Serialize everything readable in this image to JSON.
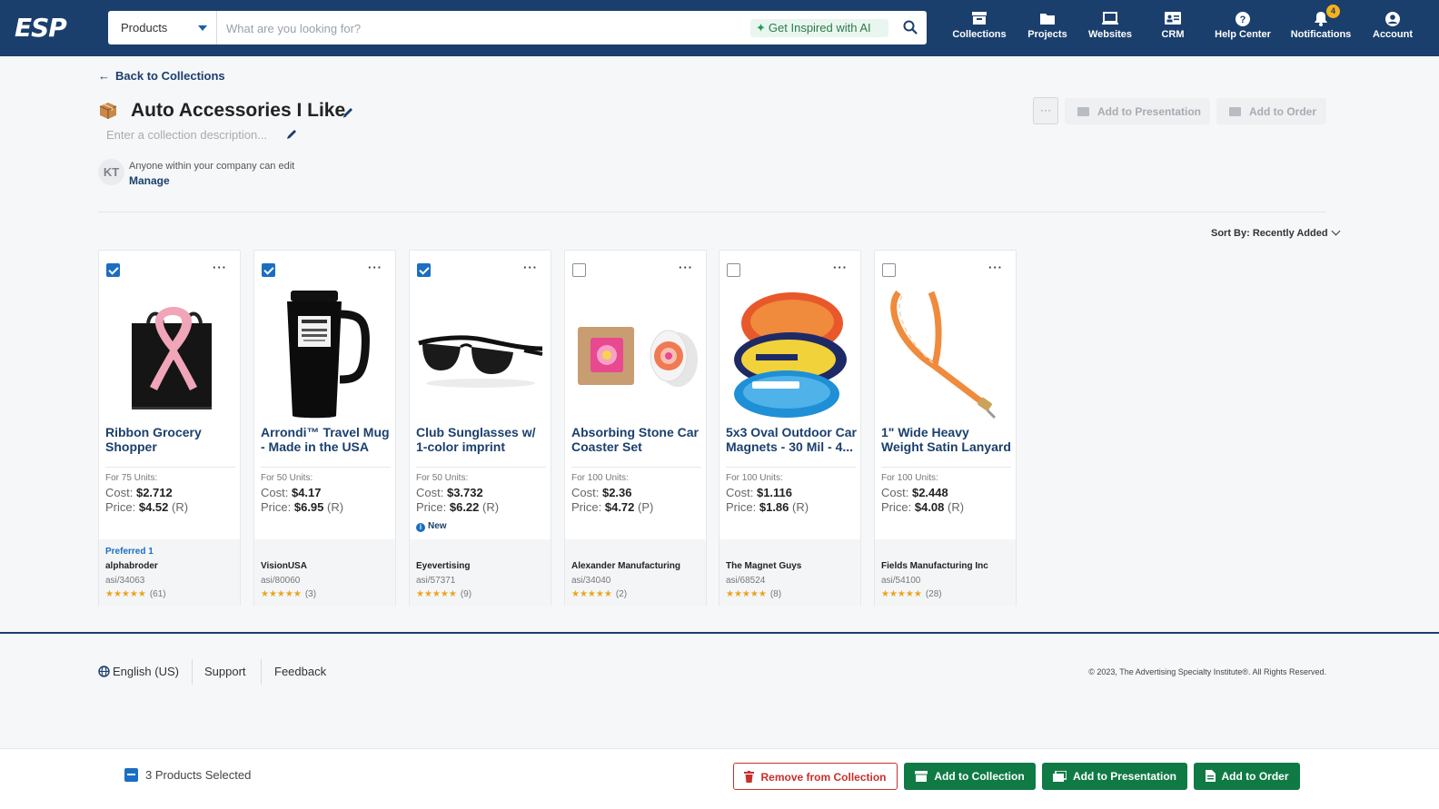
{
  "header": {
    "logo": "ESP",
    "search_category": "Products",
    "search_placeholder": "What are you looking for?",
    "ai_label": "Get Inspired with AI",
    "nav": [
      {
        "label": "Collections",
        "icon": "archive-box-icon"
      },
      {
        "label": "Projects",
        "icon": "folder-icon"
      },
      {
        "label": "Websites",
        "icon": "laptop-icon"
      },
      {
        "label": "CRM",
        "icon": "contact-card-icon"
      },
      {
        "label": "Help Center",
        "icon": "question-circle-icon"
      },
      {
        "label": "Notifications",
        "icon": "bell-icon",
        "badge": "4"
      },
      {
        "label": "Account",
        "icon": "user-circle-icon"
      }
    ]
  },
  "page": {
    "back_label": "Back to Collections",
    "title": "Auto Accessories I Like",
    "description_placeholder": "Enter a collection description...",
    "owner_initials": "KT",
    "permission_text": "Anyone within your company can edit",
    "manage_label": "Manage",
    "more_label": "···",
    "add_to_presentation": "Add to Presentation",
    "add_to_order": "Add to Order",
    "sort_label": "Sort By: Recently Added"
  },
  "products": [
    {
      "name": "Ribbon Grocery Shopper",
      "units": "For 75 Units:",
      "cost": "$2.712",
      "price": "$4.52",
      "price_code": "(R)",
      "preferred": "Preferred 1",
      "supplier": "alphabroder",
      "asi": "asi/34063",
      "rating_count": "(61)",
      "selected": true,
      "new": ""
    },
    {
      "name": "Arrondi™ Travel Mug - Made in the USA",
      "units": "For 50 Units:",
      "cost": "$4.17",
      "price": "$6.95",
      "price_code": "(R)",
      "preferred": "",
      "supplier": "VisionUSA",
      "asi": "asi/80060",
      "rating_count": "(3)",
      "selected": true,
      "new": ""
    },
    {
      "name": "Club Sunglasses w/ 1-color imprint",
      "units": "For 50 Units:",
      "cost": "$3.732",
      "price": "$6.22",
      "price_code": "(R)",
      "preferred": "",
      "supplier": "Eyevertising",
      "asi": "asi/57371",
      "rating_count": "(9)",
      "selected": true,
      "new": "New"
    },
    {
      "name": "Absorbing Stone Car Coaster Set",
      "units": "For 100 Units:",
      "cost": "$2.36",
      "price": "$4.72",
      "price_code": "(P)",
      "preferred": "",
      "supplier": "Alexander Manufacturing",
      "asi": "asi/34040",
      "rating_count": "(2)",
      "selected": false,
      "new": ""
    },
    {
      "name": "5x3 Oval Outdoor Car Magnets - 30 Mil - 4...",
      "units": "For 100 Units:",
      "cost": "$1.116",
      "price": "$1.86",
      "price_code": "(R)",
      "preferred": "",
      "supplier": "The Magnet Guys",
      "asi": "asi/68524",
      "rating_count": "(8)",
      "selected": false,
      "new": ""
    },
    {
      "name": "1\" Wide Heavy Weight Satin Lanyard",
      "units": "For 100 Units:",
      "cost": "$2.448",
      "price": "$4.08",
      "price_code": "(R)",
      "preferred": "",
      "supplier": "Fields Manufacturing Inc",
      "asi": "asi/54100",
      "rating_count": "(28)",
      "selected": false,
      "new": ""
    }
  ],
  "labels": {
    "cost": "Cost:",
    "price": "Price:"
  },
  "footer": {
    "language": "English (US)",
    "support": "Support",
    "feedback": "Feedback",
    "copyright": "© 2023, The Advertising Specialty Institute®. All Rights Reserved."
  },
  "actionbar": {
    "selected_text": "3 Products Selected",
    "remove": "Remove from Collection",
    "add_collection": "Add to Collection",
    "add_presentation": "Add to Presentation",
    "add_order": "Add to Order"
  },
  "colors": {
    "header": "#1b3f6d",
    "accent_green": "#107a45",
    "danger": "#c9302c",
    "link": "#1b6ec2"
  }
}
